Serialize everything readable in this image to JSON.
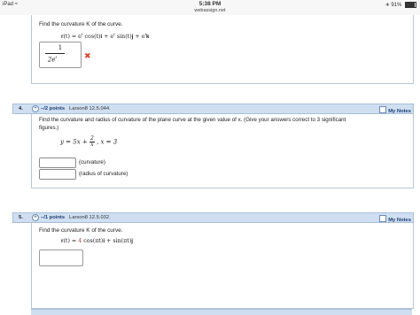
{
  "status_bar": {
    "device": "iPad",
    "wifi_icon": "wifi-icon",
    "time": "5:38 PM",
    "url": "webassign.net",
    "bluetooth_icon": "bluetooth-icon",
    "battery": "91%"
  },
  "q3": {
    "prompt": "Find the curvature K of the curve.",
    "formula_r": "r(t) = e",
    "formula_rest1": "cos(t)i + e",
    "formula_rest2": "sin(t)j + e",
    "formula_k": "k",
    "sup_t": "t",
    "answer_num": "1",
    "answer_den": "2e",
    "answer_den_sup": "t",
    "wrong_mark": "✖"
  },
  "q4": {
    "number": "4.",
    "points": "–/2 points",
    "reference": "Larson8 12.5.044.",
    "my_notes": "My Notes",
    "prompt_line1": "Find the curvature and radius of curvature of the plane curve at the given value of x. (Give your answers correct to 3 significant",
    "prompt_line2": "figures.)",
    "equation_lhs": "y = 5x +",
    "frac_num": "2",
    "frac_den": "x",
    "equation_rhs": ",  x = 3",
    "label_curvature": "(curvature)",
    "label_radius": "(radius of curvature)"
  },
  "q5": {
    "number": "5.",
    "points": "–/1 points",
    "reference": "Larson8 12.5.032.",
    "my_notes": "My Notes",
    "prompt": "Find the curvature K of the curve.",
    "formula_a": "r(t) = ",
    "formula_coef": "4",
    "formula_b": " cos(πt)i + sin(πt)j"
  },
  "colors": {
    "header_bar": "#cfdff1",
    "points_text": "#1f3f74",
    "error_red": "#e0442c",
    "coef_red": "#c0392b"
  }
}
